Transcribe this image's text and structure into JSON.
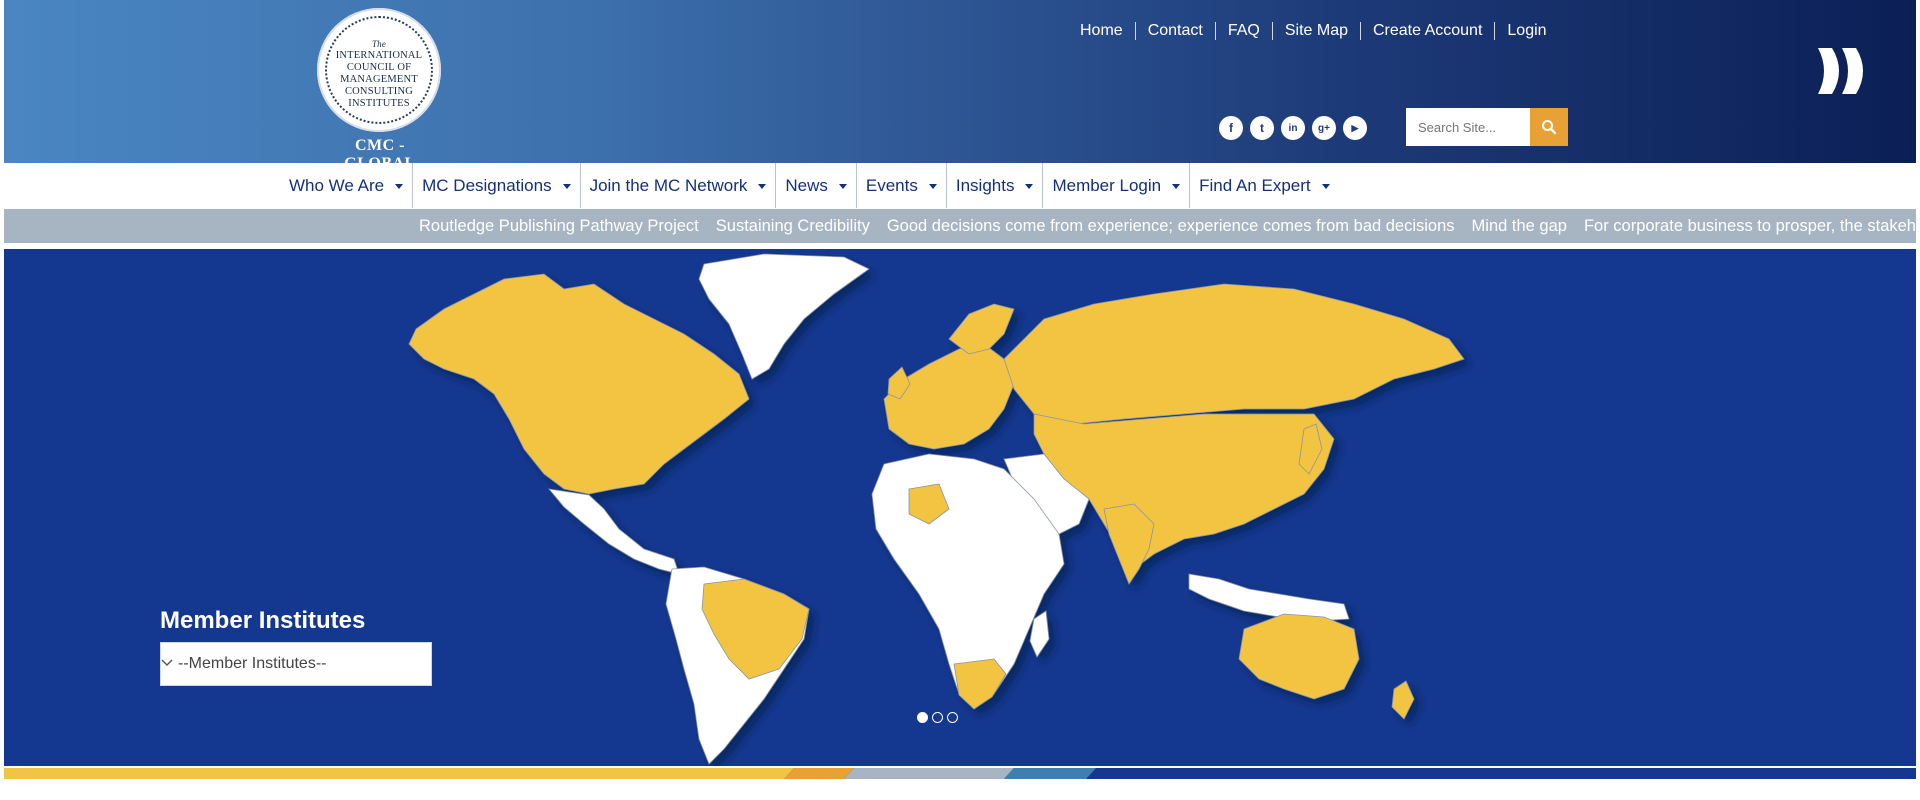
{
  "logo": {
    "the": "The",
    "lines": [
      "INTERNATIONAL",
      "COUNCIL OF",
      "MANAGEMENT",
      "CONSULTING",
      "INSTITUTES"
    ],
    "caption": "CMC - GLOBAL"
  },
  "top_links": [
    "Home",
    "Contact",
    "FAQ",
    "Site Map",
    "Create Account",
    "Login"
  ],
  "social_icons": [
    "facebook-icon",
    "twitter-icon",
    "linkedin-icon",
    "google-plus-icon",
    "youtube-icon"
  ],
  "social_glyphs": [
    "f",
    "t",
    "in",
    "g+",
    "▶"
  ],
  "search": {
    "placeholder": "Search Site..."
  },
  "nav": [
    "Who We Are",
    "MC Designations",
    "Join the MC Network",
    "News",
    "Events",
    "Insights",
    "Member Login",
    "Find An Expert"
  ],
  "ticker": [
    "Routledge Publishing Pathway Project",
    "Sustaining Credibility",
    "Good decisions come from experience; experience comes from bad decisions",
    "Mind the gap",
    "For corporate business to prosper, the stakeho"
  ],
  "member_institutes": {
    "title": "Member Institutes",
    "selected": "--Member Institutes--"
  },
  "slider": {
    "count": 3,
    "active": 1
  },
  "colors": {
    "header_dark": "#0b1f55",
    "header_light": "#4a86c2",
    "map_bg": "#14388f",
    "member_country": "#f2c443",
    "accent_orange": "#e8a134",
    "ticker_bg": "#a7b4c2",
    "nav_text": "#14307a"
  }
}
